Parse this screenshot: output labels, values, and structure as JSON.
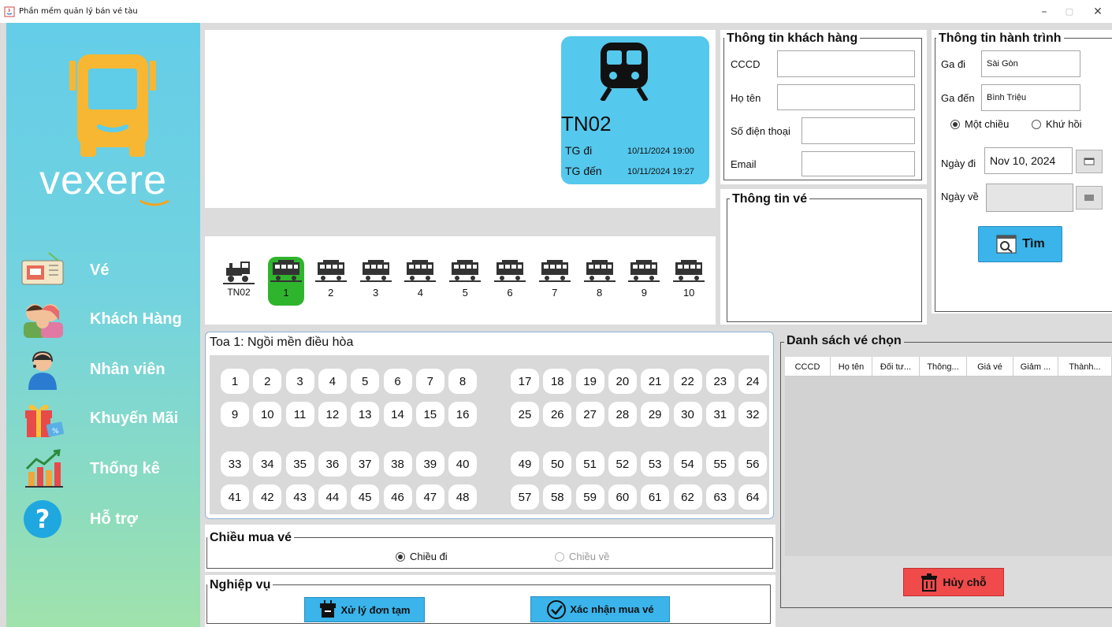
{
  "window": {
    "title": "Phần mềm quản lý bán vé tàu"
  },
  "sidebar": {
    "brand": "vexere",
    "items": [
      {
        "label": "Vé",
        "icon": "ticket-icon"
      },
      {
        "label": "Khách Hàng",
        "icon": "customers-icon"
      },
      {
        "label": "Nhân viên",
        "icon": "employee-icon"
      },
      {
        "label": "Khuyến Mãi",
        "icon": "gift-icon"
      },
      {
        "label": "Thống kê",
        "icon": "statistics-icon"
      },
      {
        "label": "Hỗ trợ",
        "icon": "help-icon"
      }
    ]
  },
  "train": {
    "code": "TN02",
    "depart_label": "TG đi",
    "depart_time": "10/11/2024 19:00",
    "arrive_label": "TG đến",
    "arrive_time": "10/11/2024 19:27"
  },
  "coaches": {
    "engine_label": "TN02",
    "items": [
      "1",
      "2",
      "3",
      "4",
      "5",
      "6",
      "7",
      "8",
      "9",
      "10"
    ],
    "selected": "1"
  },
  "seat_panel": {
    "title": "Toa 1: Ngồi mền điều hòa",
    "block_a": {
      "row1": [
        "1",
        "2",
        "3",
        "4",
        "5",
        "6",
        "7",
        "8"
      ],
      "row2": [
        "9",
        "10",
        "11",
        "12",
        "13",
        "14",
        "15",
        "16"
      ],
      "row3": [
        "33",
        "34",
        "35",
        "36",
        "37",
        "38",
        "39",
        "40"
      ],
      "row4": [
        "41",
        "42",
        "43",
        "44",
        "45",
        "46",
        "47",
        "48"
      ]
    },
    "block_b": {
      "row1": [
        "17",
        "18",
        "19",
        "20",
        "21",
        "22",
        "23",
        "24"
      ],
      "row2": [
        "25",
        "26",
        "27",
        "28",
        "29",
        "30",
        "31",
        "32"
      ],
      "row3": [
        "49",
        "50",
        "51",
        "52",
        "53",
        "54",
        "55",
        "56"
      ],
      "row4": [
        "57",
        "58",
        "59",
        "60",
        "61",
        "62",
        "63",
        "64"
      ]
    }
  },
  "customer": {
    "title": "Thông tin khách hàng",
    "cccd_label": "CCCD",
    "cccd": "",
    "name_label": "Họ tên",
    "name": "",
    "phone_label": "Số điện thoại",
    "phone": "",
    "email_label": "Email",
    "email": ""
  },
  "ticket_info": {
    "title": "Thông tin vé"
  },
  "journey": {
    "title": "Thông tin hành trình",
    "from_label": "Ga đi",
    "from": "Sài Gòn",
    "to_label": "Ga đến",
    "to": "Bình Triệu",
    "one_way": "Một chiều",
    "round_trip": "Khứ hồi",
    "depart_date_label": "Ngày đi",
    "depart_date": "Nov 10, 2024",
    "return_date_label": "Ngày về",
    "return_date": "",
    "search_button": "Tìm"
  },
  "direction": {
    "title": "Chiều mua vé",
    "outbound": "Chiều đi",
    "return": "Chiều về"
  },
  "operations": {
    "title": "Nghiệp vụ",
    "temp_orders": "Xử lý đơn tạm",
    "confirm": "Xác nhận mua vé"
  },
  "selected_tickets": {
    "title": "Danh sách vé chọn",
    "columns": [
      "CCCD",
      "Họ tên",
      "Đối tư...",
      "Thông...",
      "Giá vé",
      "Giảm ...",
      "Thành..."
    ],
    "cancel_button": "Hủy chỗ"
  },
  "colors": {
    "sidebar_top": "#64cde8",
    "sidebar_bottom": "#a0e2ac",
    "train_card": "#55c8ed",
    "selected_coach": "#2fb52d",
    "action_button": "#3ab4ea",
    "cancel_button": "#f04a4a"
  }
}
